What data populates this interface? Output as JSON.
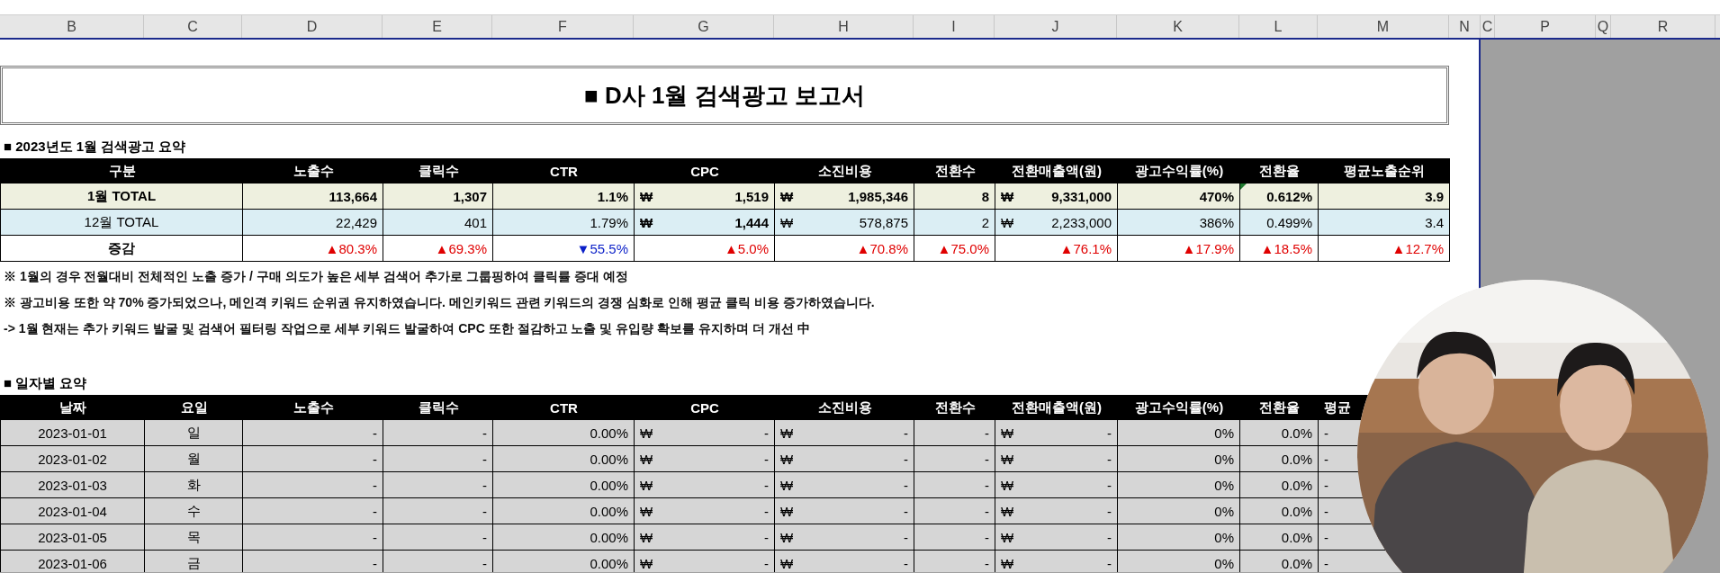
{
  "column_headers": [
    "B",
    "C",
    "D",
    "E",
    "F",
    "G",
    "H",
    "I",
    "J",
    "K",
    "L",
    "M",
    "N",
    "C",
    "P",
    "Q",
    "R"
  ],
  "title": "■ D사 1월 검색광고 보고서",
  "summary": {
    "label": "■ 2023년도 1월 검색광고 요약",
    "columns": [
      "구분",
      "노출수",
      "클릭수",
      "CTR",
      "CPC",
      "소진비용",
      "전환수",
      "전환매출액(원)",
      "광고수익률(%)",
      "전환율",
      "평균노출순위"
    ],
    "rows": [
      {
        "kind": "current",
        "cells": [
          {
            "text": "1월 TOTAL"
          },
          {
            "text": "113,664"
          },
          {
            "text": "1,307"
          },
          {
            "text": "1.1%"
          },
          {
            "currency": "₩",
            "text": "1,519"
          },
          {
            "currency": "₩",
            "text": "1,985,346"
          },
          {
            "text": "8"
          },
          {
            "currency": "₩",
            "text": "9,331,000"
          },
          {
            "text": "470%"
          },
          {
            "text": "0.612%",
            "comment": true
          },
          {
            "text": "3.9"
          }
        ]
      },
      {
        "kind": "previous",
        "cells": [
          {
            "text": "12월 TOTAL"
          },
          {
            "text": "22,429"
          },
          {
            "text": "401"
          },
          {
            "text": "1.79%"
          },
          {
            "currency": "₩",
            "text": "1,444",
            "bold": true
          },
          {
            "currency": "₩",
            "text": "578,875"
          },
          {
            "text": "2"
          },
          {
            "currency": "₩",
            "text": "2,233,000"
          },
          {
            "text": "386%"
          },
          {
            "text": "0.499%"
          },
          {
            "text": "3.4"
          }
        ]
      },
      {
        "kind": "change",
        "cells": [
          {
            "text": "증감"
          },
          {
            "text": "▲80.3%",
            "color": "#e00000"
          },
          {
            "text": "▲69.3%",
            "color": "#e00000"
          },
          {
            "text": "▼55.5%",
            "color": "#0a1fc8"
          },
          {
            "text": "▲5.0%",
            "color": "#e00000"
          },
          {
            "text": "▲70.8%",
            "color": "#e00000"
          },
          {
            "text": "▲75.0%",
            "color": "#e00000"
          },
          {
            "text": "▲76.1%",
            "color": "#e00000"
          },
          {
            "text": "▲17.9%",
            "color": "#e00000"
          },
          {
            "text": "▲18.5%",
            "color": "#e00000"
          },
          {
            "text": "▲12.7%",
            "color": "#e00000"
          }
        ]
      }
    ]
  },
  "notes": [
    "※ 1월의 경우 전월대비 전체적인 노출 증가 / 구매 의도가 높은 세부 검색어 추가로 그룹핑하여 클릭률 증대 예정",
    "※ 광고비용 또한 약 70% 증가되었으나, 메인격 키워드 순위권 유지하였습니다. 메인키워드 관련 키워드의 경쟁 심화로 인해 평균 클릭 비용 증가하였습니다.",
    "-> 1월 현재는 추가 키워드 발굴 및 검색어 필터링 작업으로 세부 키워드 발굴하여 CPC 또한 절감하고 노출 및 유입량 확보를 유지하며 더 개선 中"
  ],
  "daily": {
    "label": "■ 일자별 요약",
    "columns": [
      "날짜",
      "요일",
      "노출수",
      "클릭수",
      "CTR",
      "CPC",
      "소진비용",
      "전환수",
      "전환매출액(원)",
      "광고수익률(%)",
      "전환율",
      "평균"
    ],
    "rows": [
      {
        "cells": [
          {
            "text": "2023-01-01"
          },
          {
            "text": "일"
          },
          {
            "text": "-"
          },
          {
            "text": "-"
          },
          {
            "text": "0.00%"
          },
          {
            "currency": "₩",
            "text": "-"
          },
          {
            "currency": "₩",
            "text": "-"
          },
          {
            "text": "-"
          },
          {
            "currency": "₩",
            "text": "-"
          },
          {
            "text": "0%"
          },
          {
            "text": "0.0%"
          },
          {
            "text": "-"
          }
        ]
      },
      {
        "cells": [
          {
            "text": "2023-01-02"
          },
          {
            "text": "월"
          },
          {
            "text": "-"
          },
          {
            "text": "-"
          },
          {
            "text": "0.00%"
          },
          {
            "currency": "₩",
            "text": "-"
          },
          {
            "currency": "₩",
            "text": "-"
          },
          {
            "text": "-"
          },
          {
            "currency": "₩",
            "text": "-"
          },
          {
            "text": "0%"
          },
          {
            "text": "0.0%"
          },
          {
            "text": "-"
          }
        ]
      },
      {
        "cells": [
          {
            "text": "2023-01-03"
          },
          {
            "text": "화"
          },
          {
            "text": "-"
          },
          {
            "text": "-"
          },
          {
            "text": "0.00%"
          },
          {
            "currency": "₩",
            "text": "-"
          },
          {
            "currency": "₩",
            "text": "-"
          },
          {
            "text": "-"
          },
          {
            "currency": "₩",
            "text": "-"
          },
          {
            "text": "0%"
          },
          {
            "text": "0.0%"
          },
          {
            "text": "-"
          }
        ]
      },
      {
        "cells": [
          {
            "text": "2023-01-04"
          },
          {
            "text": "수"
          },
          {
            "text": "-"
          },
          {
            "text": "-"
          },
          {
            "text": "0.00%"
          },
          {
            "currency": "₩",
            "text": "-"
          },
          {
            "currency": "₩",
            "text": "-"
          },
          {
            "text": "-"
          },
          {
            "currency": "₩",
            "text": "-"
          },
          {
            "text": "0%"
          },
          {
            "text": "0.0%"
          },
          {
            "text": "-"
          }
        ]
      },
      {
        "cells": [
          {
            "text": "2023-01-05"
          },
          {
            "text": "목"
          },
          {
            "text": "-"
          },
          {
            "text": "-"
          },
          {
            "text": "0.00%"
          },
          {
            "currency": "₩",
            "text": "-"
          },
          {
            "currency": "₩",
            "text": "-"
          },
          {
            "text": "-"
          },
          {
            "currency": "₩",
            "text": "-"
          },
          {
            "text": "0%"
          },
          {
            "text": "0.0%"
          },
          {
            "text": "-"
          }
        ]
      },
      {
        "cells": [
          {
            "text": "2023-01-06"
          },
          {
            "text": "금"
          },
          {
            "text": "-"
          },
          {
            "text": "-"
          },
          {
            "text": "0.00%"
          },
          {
            "currency": "₩",
            "text": "-"
          },
          {
            "currency": "₩",
            "text": "-"
          },
          {
            "text": "-"
          },
          {
            "currency": "₩",
            "text": "-"
          },
          {
            "text": "0%"
          },
          {
            "text": "0.0%"
          },
          {
            "text": "-"
          }
        ]
      }
    ]
  }
}
